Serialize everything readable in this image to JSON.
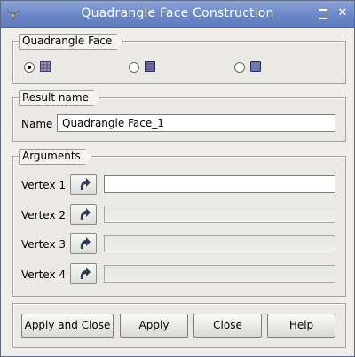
{
  "window": {
    "title": "Quadrangle Face Construction"
  },
  "groups": {
    "type": {
      "title": "Quadrangle Face",
      "selected_index": 0
    },
    "result": {
      "title": "Result name",
      "name_label": "Name",
      "name_value": "Quadrangle Face_1"
    },
    "arguments": {
      "title": "Arguments",
      "vertices": [
        {
          "label": "Vertex 1",
          "value": "",
          "enabled": true
        },
        {
          "label": "Vertex 2",
          "value": "",
          "enabled": false
        },
        {
          "label": "Vertex 3",
          "value": "",
          "enabled": false
        },
        {
          "label": "Vertex 4",
          "value": "",
          "enabled": false
        }
      ]
    }
  },
  "buttons": {
    "apply_close": "Apply and Close",
    "apply": "Apply",
    "close": "Close",
    "help": "Help"
  },
  "colors": {
    "titlebar": "#6d89c8",
    "accent": "#2e3a5a"
  }
}
